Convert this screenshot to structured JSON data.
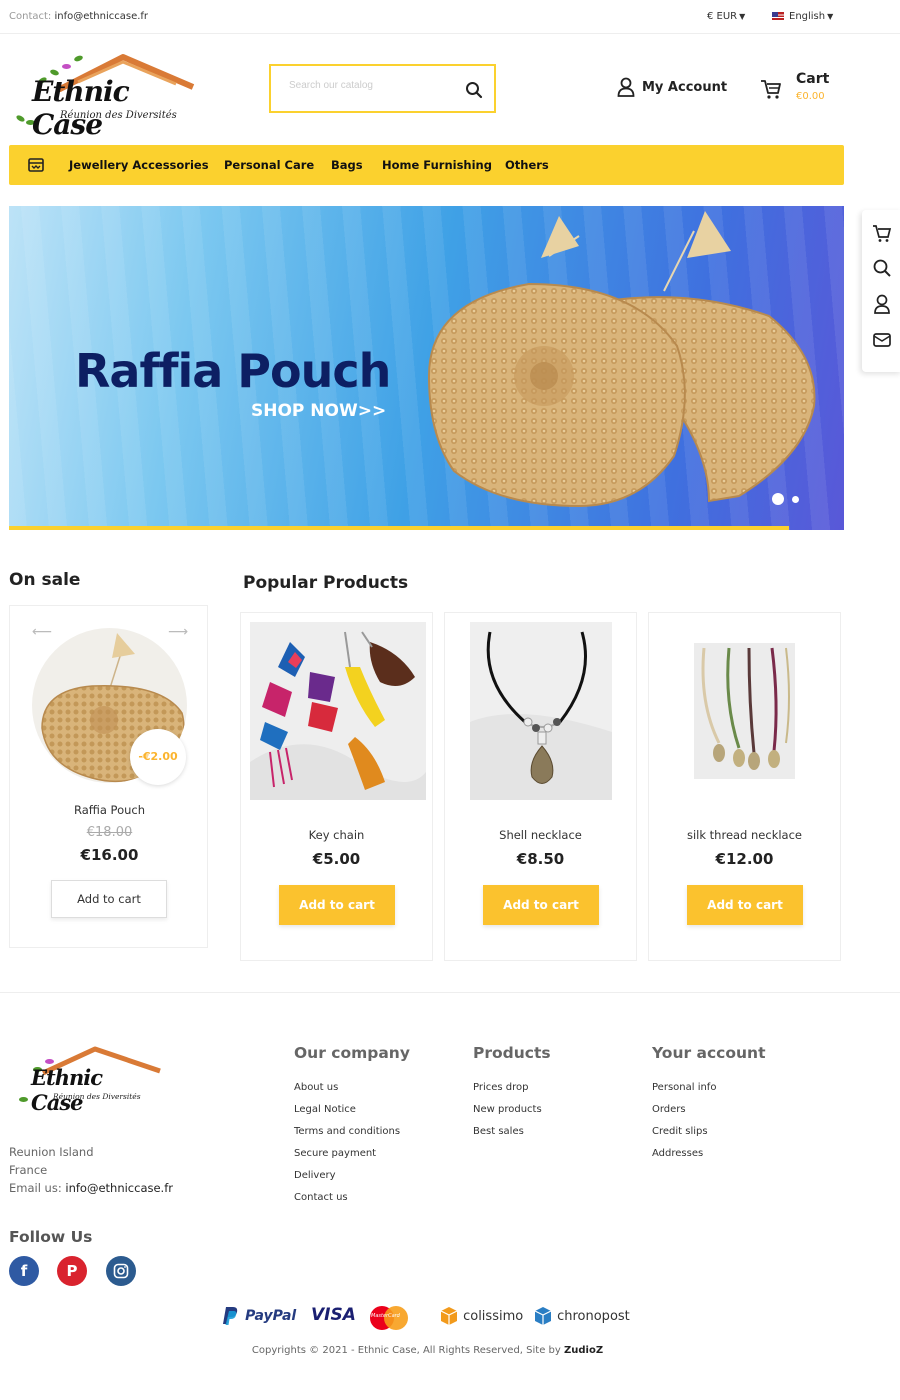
{
  "topbar": {
    "contact_label": "Contact:",
    "contact_email": "info@ethniccase.fr",
    "currency": "€ EUR",
    "language": "English"
  },
  "logo": {
    "name": "Ethnic Case",
    "tagline": "Réunion des Diversités"
  },
  "search": {
    "placeholder": "Search our catalog"
  },
  "header": {
    "account_label": "My Account",
    "cart_label": "Cart",
    "cart_total": "€0.00"
  },
  "nav": {
    "items": [
      {
        "label": "Jewellery Accessories"
      },
      {
        "label": "Personal Care"
      },
      {
        "label": "Bags"
      },
      {
        "label": "Home Furnishing"
      },
      {
        "label": "Others"
      }
    ]
  },
  "banner": {
    "title": "Raffia Pouch",
    "cta": "SHOP NOW>>",
    "slides": 2,
    "active_slide": 1
  },
  "on_sale": {
    "heading": "On sale",
    "product": {
      "name": "Raffia Pouch",
      "discount": "-€2.00",
      "old_price": "€18.00",
      "price": "€16.00",
      "button": "Add to cart"
    }
  },
  "popular": {
    "heading": "Popular Products",
    "products": [
      {
        "name": "Key chain",
        "price": "€5.00",
        "button": "Add to cart"
      },
      {
        "name": "Shell necklace",
        "price": "€8.50",
        "button": "Add to cart"
      },
      {
        "name": "silk thread necklace",
        "price": "€12.00",
        "button": "Add to cart"
      }
    ]
  },
  "footer": {
    "address_lines": [
      "Reunion Island",
      "France"
    ],
    "email_label": "Email us:",
    "email": "info@ethniccase.fr",
    "company": {
      "heading": "Our company",
      "links": [
        "About us",
        "Legal Notice",
        "Terms and conditions",
        "Secure payment",
        "Delivery",
        "Contact us"
      ]
    },
    "products": {
      "heading": "Products",
      "links": [
        "Prices drop",
        "New products",
        "Best sales"
      ]
    },
    "account": {
      "heading": "Your account",
      "links": [
        "Personal info",
        "Orders",
        "Credit slips",
        "Addresses"
      ]
    },
    "follow_heading": "Follow Us",
    "social": [
      "facebook-icon",
      "pinterest-icon",
      "instagram-icon"
    ],
    "payment": {
      "paypal": "PayPal",
      "visa": "VISA",
      "mastercard": "MasterCard",
      "colissimo": "colissimo",
      "chronopost": "chronopost"
    },
    "copyright": "Copyrights © 2021 - Ethnic Case, All Rights Reserved, Site by",
    "credit": "ZudioZ"
  },
  "colors": {
    "accent": "#fbd12e",
    "button": "#fbc22e",
    "price_accent": "#fbb42e",
    "banner_title": "#0d1f63"
  }
}
